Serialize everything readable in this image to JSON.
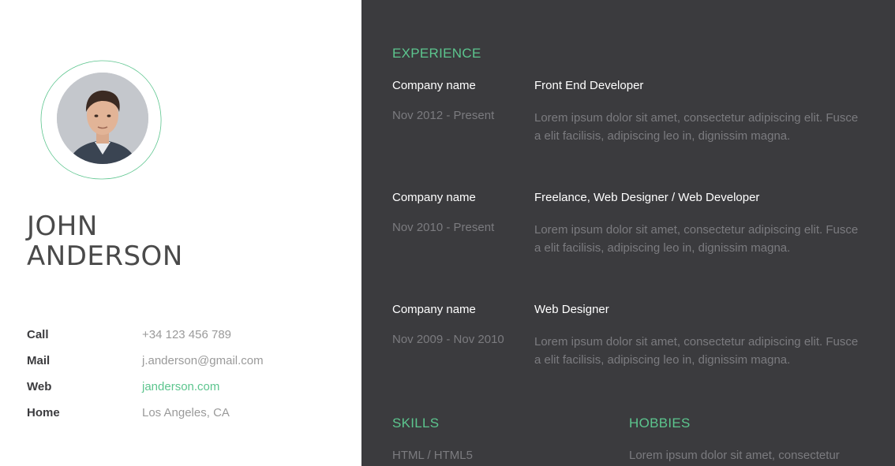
{
  "profile": {
    "first_name": "JOHN",
    "last_name": "ANDERSON",
    "photo_icon": "person-portrait-icon"
  },
  "contacts": [
    {
      "label": "Call",
      "value": "+34 123 456 789"
    },
    {
      "label": "Mail",
      "value": "j.anderson@gmail.com"
    },
    {
      "label": "Web",
      "value": "janderson.com"
    },
    {
      "label": "Home",
      "value": "Los Angeles, CA"
    }
  ],
  "experience": {
    "title": "EXPERIENCE",
    "items": [
      {
        "company": "Company name",
        "role": "Front End Developer",
        "dates": "Nov 2012 - Present",
        "description": "Lorem ipsum dolor sit amet, consectetur adipiscing elit. Fusce a elit facilisis, adipiscing leo in, dignissim magna."
      },
      {
        "company": "Company name",
        "role": "Freelance, Web Designer / Web Developer",
        "dates": "Nov 2010 - Present",
        "description": "Lorem ipsum dolor sit amet, consectetur adipiscing elit. Fusce a elit facilisis, adipiscing leo in, dignissim magna."
      },
      {
        "company": "Company name",
        "role": "Web Designer",
        "dates": "Nov 2009 - Nov 2010",
        "description": "Lorem ipsum dolor sit amet, consectetur adipiscing elit. Fusce a elit facilisis, adipiscing leo in, dignissim magna."
      }
    ]
  },
  "skills": {
    "title": "SKILLS",
    "first_item": "HTML / HTML5"
  },
  "hobbies": {
    "title": "HOBBIES",
    "text": "Lorem ipsum dolor sit amet, consectetur"
  },
  "colors": {
    "accent": "#5cc58e",
    "dark_panel": "#3b3b3e",
    "muted_text": "#7b7b7f"
  }
}
